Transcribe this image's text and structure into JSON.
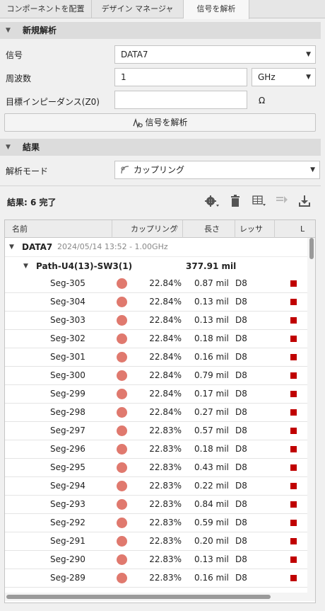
{
  "tabs": [
    "コンポーネントを配置",
    "デザイン マネージャ",
    "信号を解析"
  ],
  "new_analysis": {
    "title": "新規解析",
    "signal_label": "信号",
    "signal_value": "DATA7",
    "freq_label": "周波数",
    "freq_value": "1",
    "freq_unit": "GHz",
    "impedance_label": "目標インピーダンス(Z0)",
    "impedance_value": "",
    "impedance_unit": "Ω",
    "analyze_button": "信号を解析"
  },
  "results": {
    "title": "結果",
    "mode_label": "解析モード",
    "mode_value": "カップリング",
    "summary_prefix": "結果:",
    "summary_count": "6",
    "summary_suffix": "完了"
  },
  "table": {
    "headers": [
      "名前",
      "カップリング",
      "長さ",
      "レッサ",
      "L"
    ],
    "group": {
      "name": "DATA7",
      "meta": "2024/05/14 13:52 - 1.00GHz"
    },
    "path": {
      "name": "Path-U4(13)-SW3(1)",
      "length": "377.91 mil"
    },
    "rows": [
      {
        "seg": "Seg-305",
        "pct": "22.84%",
        "len": "0.87 mil",
        "layer": "D8"
      },
      {
        "seg": "Seg-304",
        "pct": "22.84%",
        "len": "0.13 mil",
        "layer": "D8"
      },
      {
        "seg": "Seg-303",
        "pct": "22.84%",
        "len": "0.13 mil",
        "layer": "D8"
      },
      {
        "seg": "Seg-302",
        "pct": "22.84%",
        "len": "0.18 mil",
        "layer": "D8"
      },
      {
        "seg": "Seg-301",
        "pct": "22.84%",
        "len": "0.16 mil",
        "layer": "D8"
      },
      {
        "seg": "Seg-300",
        "pct": "22.84%",
        "len": "0.79 mil",
        "layer": "D8"
      },
      {
        "seg": "Seg-299",
        "pct": "22.84%",
        "len": "0.17 mil",
        "layer": "D8"
      },
      {
        "seg": "Seg-298",
        "pct": "22.84%",
        "len": "0.27 mil",
        "layer": "D8"
      },
      {
        "seg": "Seg-297",
        "pct": "22.83%",
        "len": "0.57 mil",
        "layer": "D8"
      },
      {
        "seg": "Seg-296",
        "pct": "22.83%",
        "len": "0.18 mil",
        "layer": "D8"
      },
      {
        "seg": "Seg-295",
        "pct": "22.83%",
        "len": "0.43 mil",
        "layer": "D8"
      },
      {
        "seg": "Seg-294",
        "pct": "22.83%",
        "len": "0.22 mil",
        "layer": "D8"
      },
      {
        "seg": "Seg-293",
        "pct": "22.83%",
        "len": "0.84 mil",
        "layer": "D8"
      },
      {
        "seg": "Seg-292",
        "pct": "22.83%",
        "len": "0.59 mil",
        "layer": "D8"
      },
      {
        "seg": "Seg-291",
        "pct": "22.83%",
        "len": "0.20 mil",
        "layer": "D8"
      },
      {
        "seg": "Seg-290",
        "pct": "22.83%",
        "len": "0.13 mil",
        "layer": "D8"
      },
      {
        "seg": "Seg-289",
        "pct": "22.83%",
        "len": "0.16 mil",
        "layer": "D8"
      }
    ]
  },
  "colors": {
    "coupling_dot": "#e0796e",
    "layer_square": "#c00000"
  }
}
